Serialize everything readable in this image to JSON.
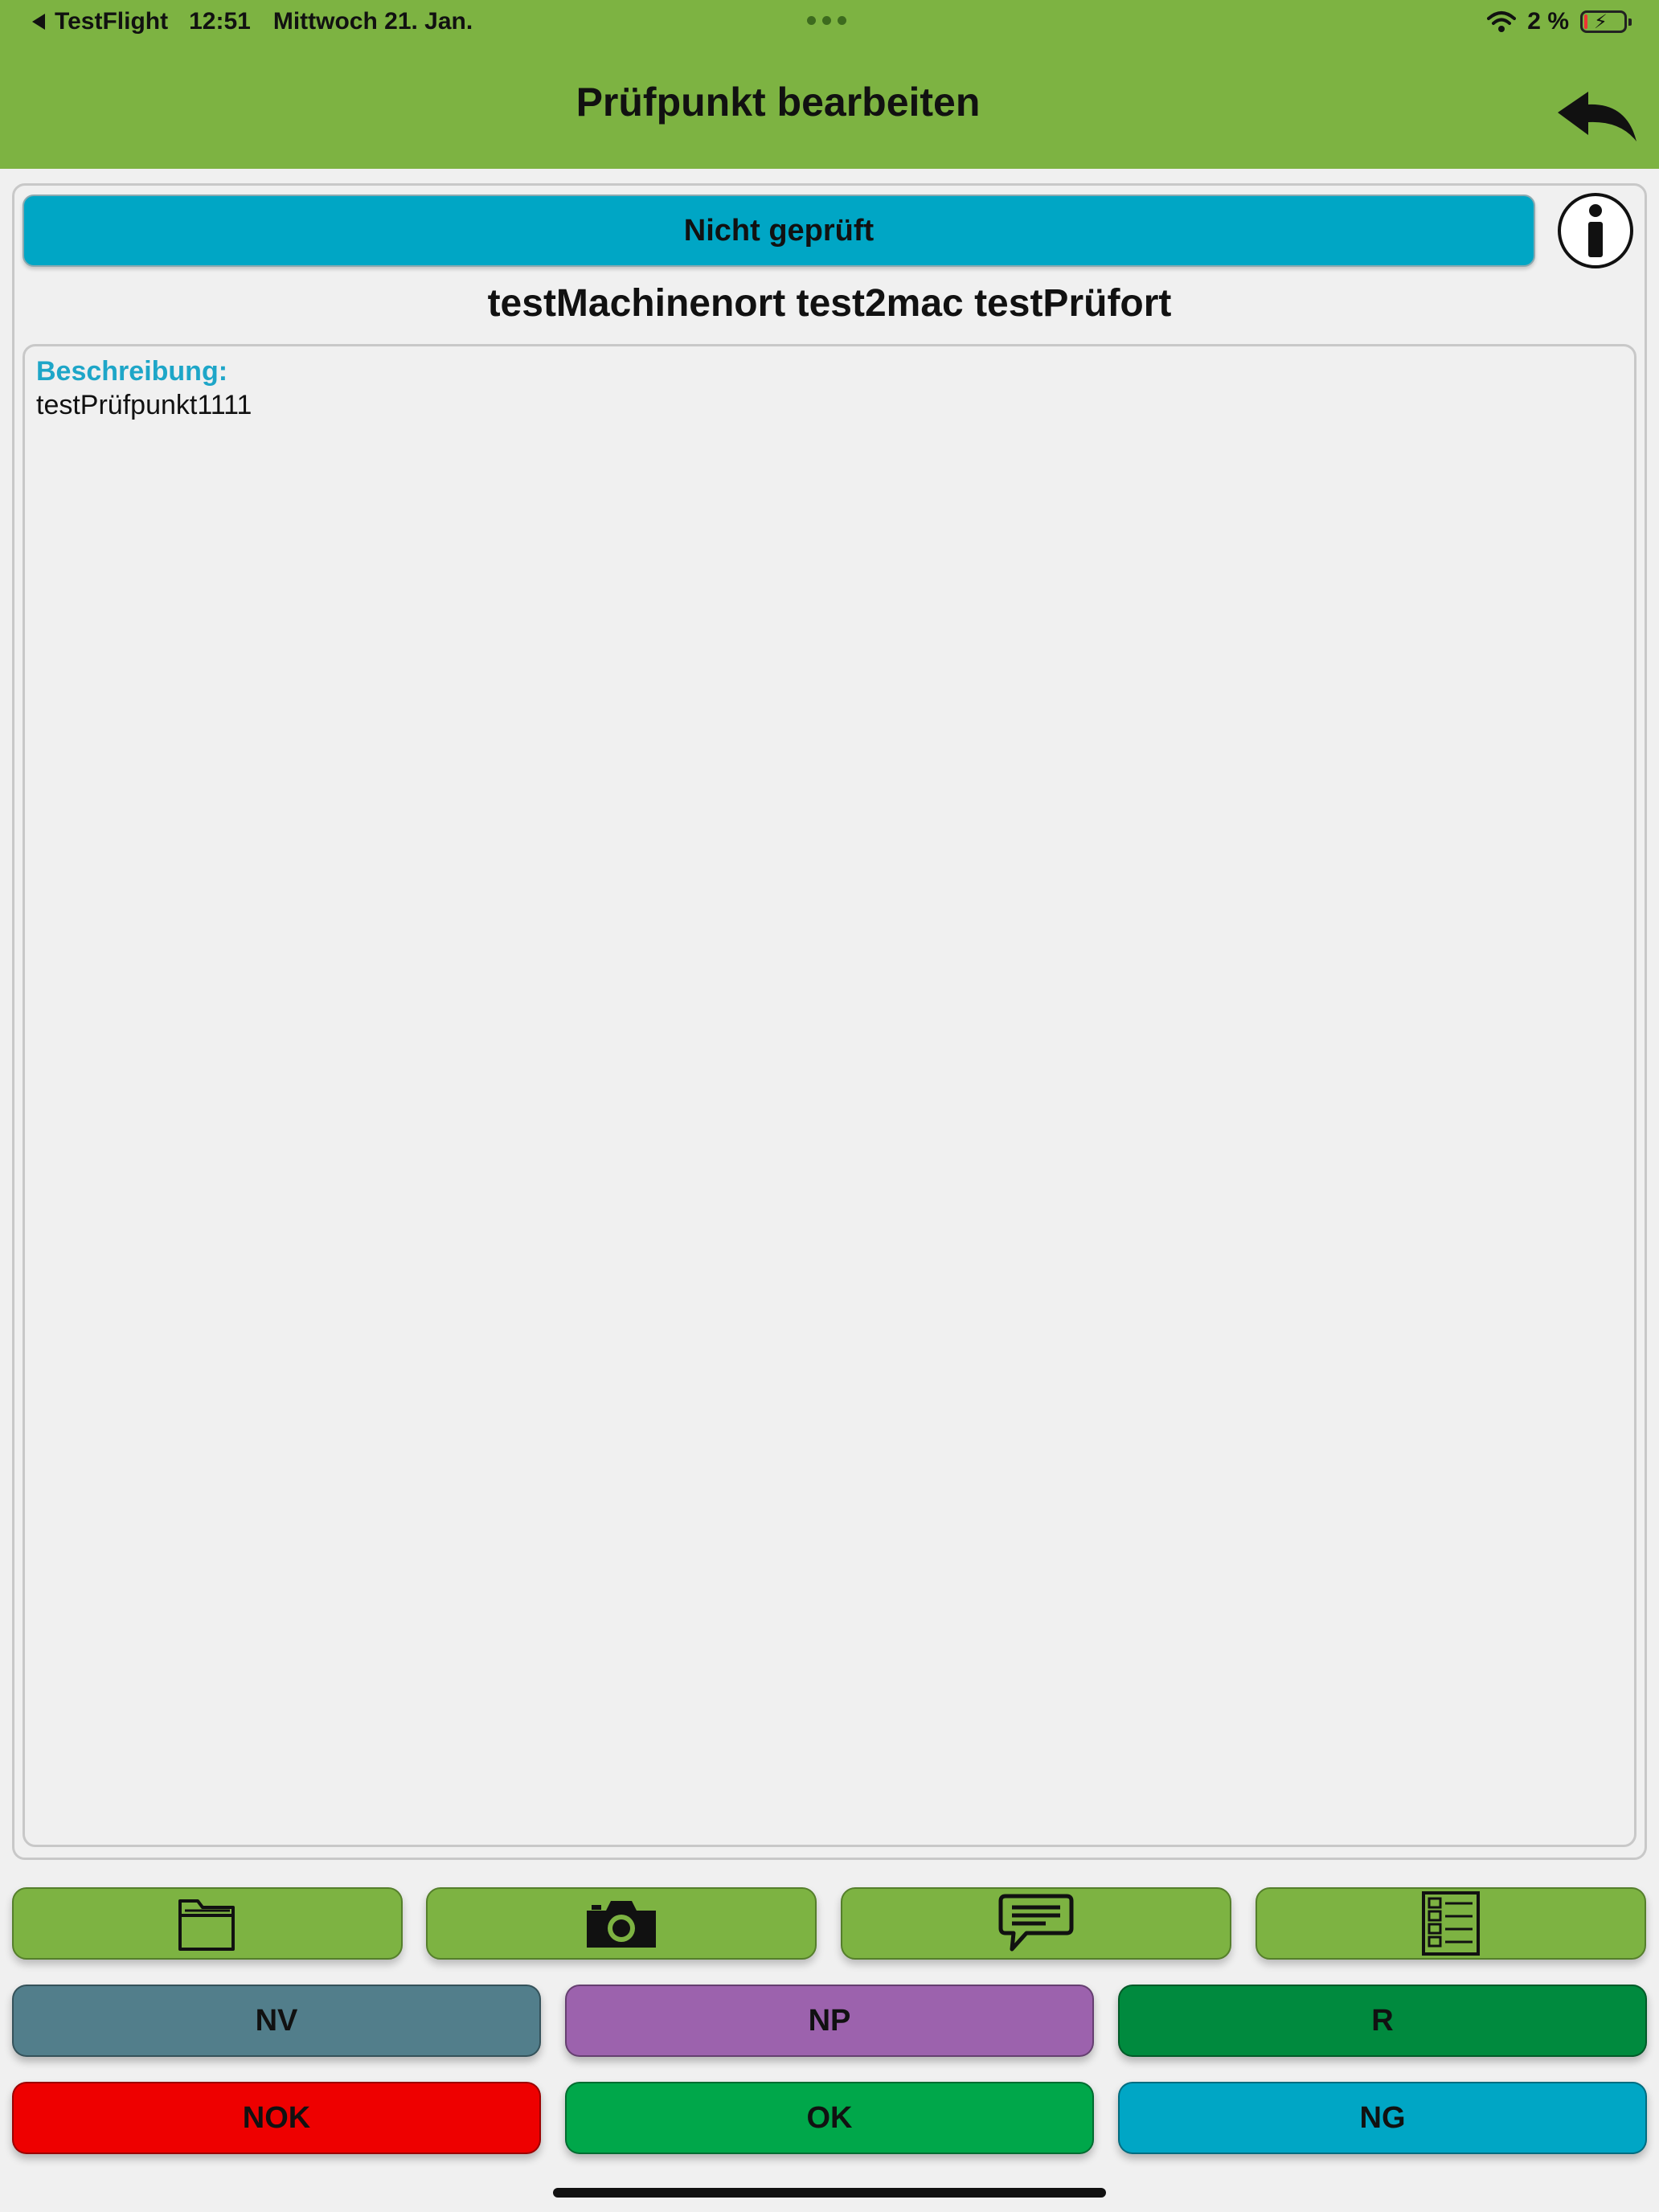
{
  "status_bar": {
    "app_back": "TestFlight",
    "time": "12:51",
    "date": "Mittwoch 21. Jan.",
    "battery": "2 %",
    "bolt": "⚡"
  },
  "header": {
    "title": "Prüfpunkt bearbeiten",
    "background_color": "#7db342"
  },
  "status_button": {
    "label": "Nicht geprüft",
    "color": "#00a6c5"
  },
  "location": "testMachinenort test2mac testPrüfort",
  "description": {
    "label": "Beschreibung:",
    "text": "testPrüfpunkt1111"
  },
  "toolbar": {
    "items": [
      {
        "icon": "folder-icon"
      },
      {
        "icon": "camera-icon"
      },
      {
        "icon": "comment-icon"
      },
      {
        "icon": "checklist-icon"
      }
    ]
  },
  "result_buttons": [
    {
      "label": "NV",
      "color": "#527e8b"
    },
    {
      "label": "NP",
      "color": "#9c62ad"
    },
    {
      "label": "R",
      "color": "#008a3e"
    },
    {
      "label": "NOK",
      "color": "#ee0000"
    },
    {
      "label": "OK",
      "color": "#00a74a"
    },
    {
      "label": "NG",
      "color": "#00a6c5"
    }
  ]
}
